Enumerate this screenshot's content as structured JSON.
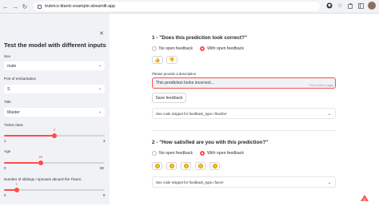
{
  "browser": {
    "url": "trubrics-titanic-example.streamlit.app",
    "back_glyph": "←",
    "forward_glyph": "→",
    "reload_glyph": "↻",
    "icons": [
      "github-icon",
      "star-icon",
      "extensions-icon",
      "sidebar-icon",
      "avatar"
    ]
  },
  "sidebar": {
    "close_glyph": "✕",
    "title": "Test the model with different inputs",
    "sex": {
      "label": "Sex",
      "value": "male"
    },
    "port": {
      "label": "Port of embarkation",
      "value": "S"
    },
    "title_field": {
      "label": "Title",
      "value": "Master"
    },
    "ticket_class": {
      "label": "Ticket class",
      "value": "2",
      "min": "1",
      "max": "3",
      "fraction": 0.5
    },
    "age": {
      "label": "Age",
      "value": "29",
      "min": "0",
      "max": "80",
      "fraction": 0.3625
    },
    "siblings": {
      "label": "Number of siblings / spouses aboard the Titanic",
      "value": "1",
      "min": "0",
      "max": "8",
      "fraction": 0.125
    }
  },
  "main": {
    "q1": {
      "title": "1 - \"Does this prediction look correct?\"",
      "options": [
        "No open feedback",
        "With open feedback"
      ],
      "selected": 1,
      "thumbs_up": "👍",
      "thumbs_down": "👎",
      "desc_label": "Please provide a description",
      "input_value": "This prediction looks incorrect...",
      "input_hint": "Press Enter to apply",
      "save_label": "Save feedback",
      "code_label": "See code snippet for feedback_type='thumbs'"
    },
    "q2": {
      "title": "2 - \"How satisfied are you with this prediction?\"",
      "options": [
        "No open feedback",
        "With open feedback"
      ],
      "selected": 1,
      "code_label": "See code snippet for feedback_type='faces'"
    }
  },
  "colors": {
    "accent": "#ff4b4b",
    "sidebar_bg": "#f0f2f6"
  }
}
